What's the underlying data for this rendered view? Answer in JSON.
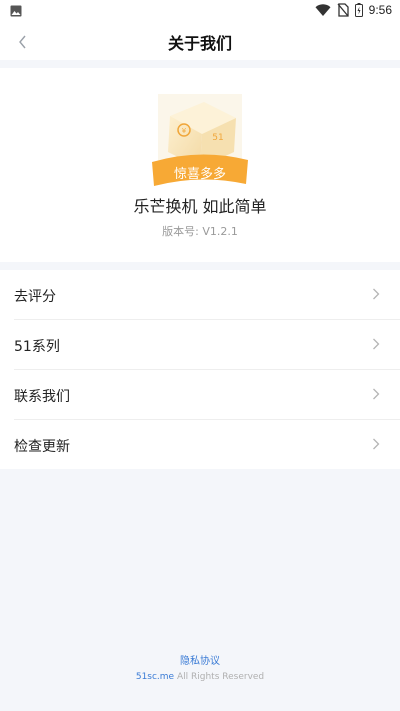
{
  "status_bar": {
    "time": "9:56"
  },
  "nav": {
    "title": "关于我们"
  },
  "about": {
    "logo_banner": "惊喜多多",
    "slogan": "乐芒换机 如此简单",
    "version": "版本号: V1.2.1"
  },
  "menu": {
    "items": [
      {
        "label": "去评分"
      },
      {
        "label": "51系列"
      },
      {
        "label": "联系我们"
      },
      {
        "label": "检查更新"
      }
    ]
  },
  "footer": {
    "privacy": "隐私协议",
    "domain": "51sc.me",
    "rights": "All Rights Reserved"
  },
  "colors": {
    "accent": "#3a7bd5",
    "logo_orange": "#f7a935",
    "logo_box": "#fbe6b8",
    "page_bg": "#f4f6fa"
  },
  "icons": [
    "gallery-icon",
    "wifi-icon",
    "no-sim-icon",
    "battery-icon",
    "back-arrow-icon",
    "chevron-right-icon"
  ]
}
